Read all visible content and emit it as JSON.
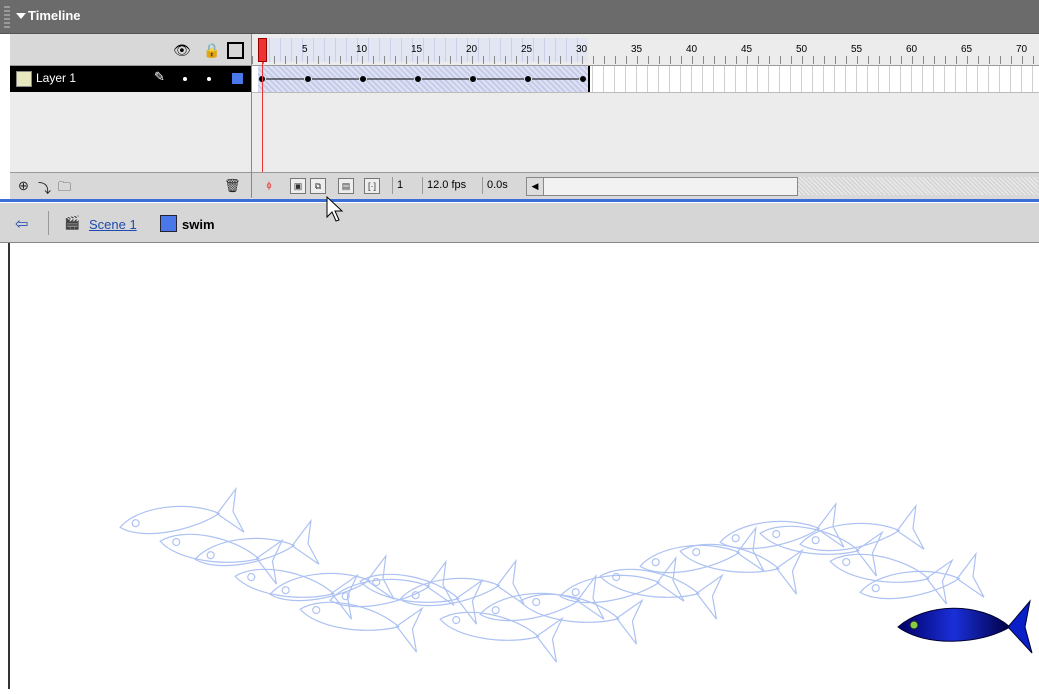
{
  "panel": {
    "title": "Timeline"
  },
  "layers": [
    {
      "name": "Layer 1"
    }
  ],
  "ruler": {
    "labels": [
      "5",
      "10",
      "15",
      "20",
      "25",
      "30",
      "35",
      "40",
      "45",
      "50",
      "55",
      "60",
      "65",
      "70"
    ]
  },
  "controls": {
    "current_frame": "1",
    "frame_rate": "12.0 fps",
    "elapsed_time": "0.0s"
  },
  "nav": {
    "scene": "Scene 1",
    "symbol": "swim"
  },
  "colors": {
    "tween_fill": "#dfe2f4",
    "onion_skin": "#9eb8f0",
    "fish": "#0a1fc8",
    "selection": "#4a78e8"
  }
}
